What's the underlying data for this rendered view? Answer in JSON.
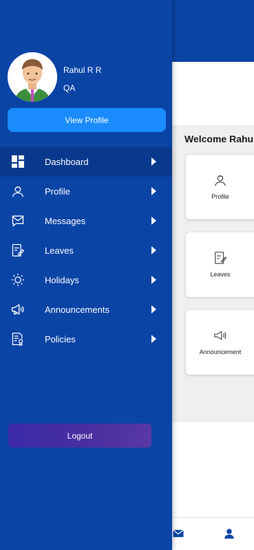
{
  "user": {
    "name": "Rahul R R",
    "role": "QA"
  },
  "drawer": {
    "view_profile_label": "View Profile",
    "logout_label": "Logout",
    "menu": [
      {
        "label": "Dashboard",
        "icon": "dashboard-icon",
        "active": true
      },
      {
        "label": "Profile",
        "icon": "profile-icon",
        "active": false
      },
      {
        "label": "Messages",
        "icon": "messages-icon",
        "active": false
      },
      {
        "label": "Leaves",
        "icon": "leaves-icon",
        "active": false
      },
      {
        "label": "Holidays",
        "icon": "holidays-icon",
        "active": false
      },
      {
        "label": "Announcements",
        "icon": "announcements-icon",
        "active": false
      },
      {
        "label": "Policies",
        "icon": "policies-icon",
        "active": false
      }
    ]
  },
  "main": {
    "welcome": "Welcome Rahu",
    "cards": [
      {
        "label": "Profile",
        "icon": "profile-icon"
      },
      {
        "label": "Leaves",
        "icon": "leaves-icon"
      },
      {
        "label": "Announcement",
        "icon": "announcement-icon"
      }
    ]
  },
  "bottom_nav": {
    "items": [
      "mail-icon",
      "person-icon"
    ]
  },
  "colors": {
    "primary": "#0a44a5",
    "active_row": "#08398c",
    "button": "#1a8cff",
    "logout": "#3a2aa8"
  }
}
